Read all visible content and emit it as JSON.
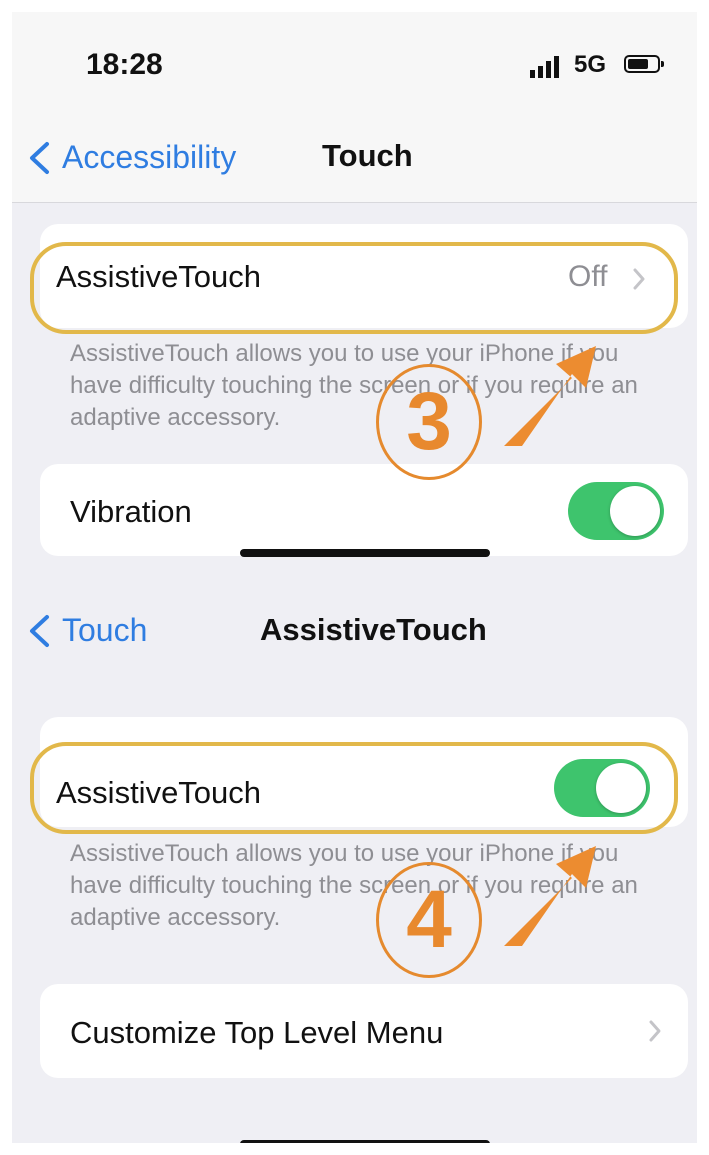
{
  "status_bar": {
    "time": "18:28",
    "network": "5G"
  },
  "screen_touch": {
    "back_label": "Accessibility",
    "title": "Touch",
    "assistive_label": "AssistiveTouch",
    "assistive_value": "Off",
    "assistive_description": "AssistiveTouch allows you to use your iPhone if you have difficulty touching the screen or if you require an adaptive accessory.",
    "vibration_label": "Vibration",
    "vibration_on": true
  },
  "screen_assistive": {
    "back_label": "Touch",
    "title": "AssistiveTouch",
    "assistive_label": "AssistiveTouch",
    "assistive_on": true,
    "assistive_description": "AssistiveTouch allows you to use your iPhone if you have difficulty touching the screen or if you require an adaptive accessory.",
    "customize_label": "Customize Top Level Menu"
  },
  "annotations": {
    "step_3": "3",
    "step_4": "4"
  },
  "colors": {
    "accent": "#2f7de1",
    "toggle_on": "#3ec46d",
    "highlight": "#e2b84a",
    "annotation": "#e8892e"
  },
  "icons": [
    "signal-icon",
    "battery-icon",
    "chevron-left-icon",
    "chevron-right-icon",
    "arrow-icon"
  ]
}
